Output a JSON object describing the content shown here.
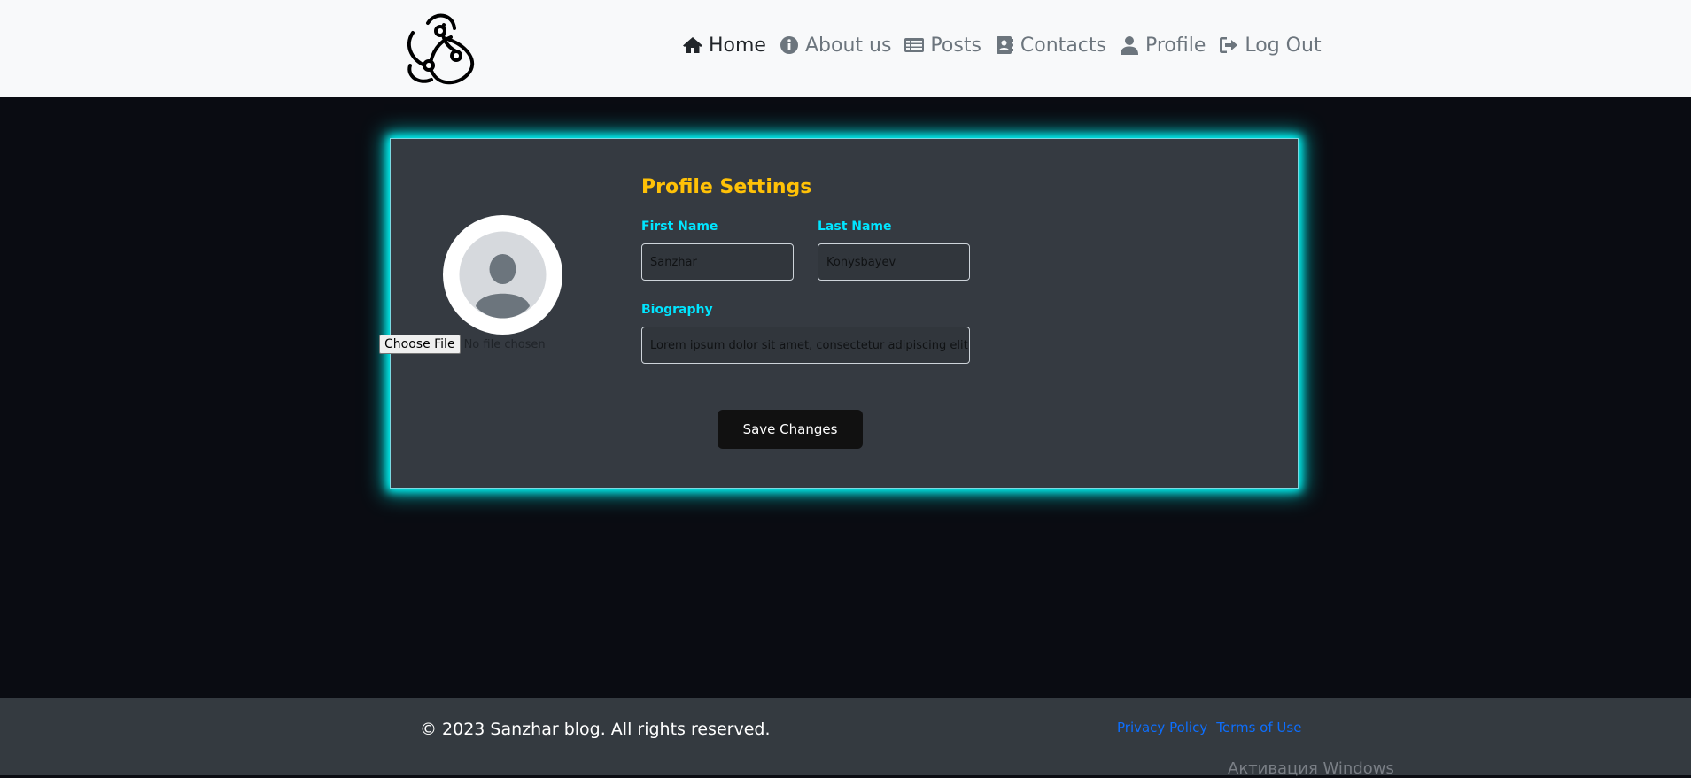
{
  "nav": {
    "items": [
      {
        "label": "Home",
        "icon": "home-icon"
      },
      {
        "label": "About us",
        "icon": "info-icon"
      },
      {
        "label": "Posts",
        "icon": "list-icon"
      },
      {
        "label": "Contacts",
        "icon": "address-book-icon"
      },
      {
        "label": "Profile",
        "icon": "user-icon"
      },
      {
        "label": "Log Out",
        "icon": "sign-out-icon"
      }
    ]
  },
  "profile": {
    "title": "Profile Settings",
    "file_button": "Choose File",
    "file_status": "No file chosen",
    "first_name_label": "First Name",
    "first_name_value": "Sanzhar",
    "last_name_label": "Last Name",
    "last_name_value": "Konysbayev",
    "biography_label": "Biography",
    "biography_value": "Lorem ipsum dolor sit amet, consectetur adipiscing elit",
    "save_button": "Save Changes"
  },
  "footer": {
    "copyright": "© 2023 Sanzhar blog. All rights reserved.",
    "links": [
      "Privacy Policy",
      "Terms of Use"
    ]
  },
  "watermark": "Активация Windows",
  "colors": {
    "accent_glow": "#00ffff",
    "title": "#ffc107",
    "label": "#00e5ff",
    "link": "#0d6efd"
  }
}
